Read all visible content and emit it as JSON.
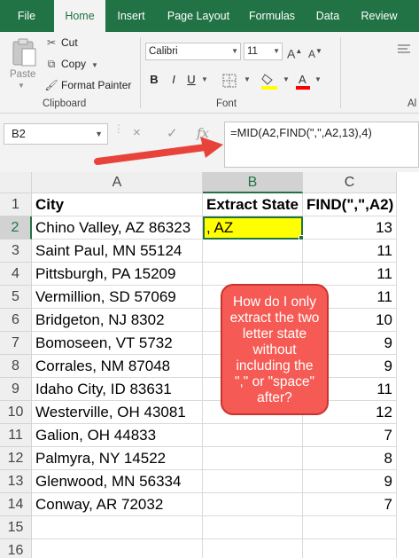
{
  "ribbon": {
    "tabs": [
      "File",
      "Home",
      "Insert",
      "Page Layout",
      "Formulas",
      "Data",
      "Review"
    ],
    "active_tab": "Home",
    "clipboard": {
      "paste_label": "Paste",
      "cut_label": "Cut",
      "copy_label": "Copy",
      "format_painter_label": "Format Painter",
      "group_label": "Clipboard"
    },
    "font": {
      "font_name": "Calibri",
      "font_size": "11",
      "bold": "B",
      "italic": "I",
      "underline": "U",
      "group_label": "Font",
      "fill_color": "#ffff00",
      "font_color": "#ff0000"
    },
    "alignment_group_label_partial": "Al"
  },
  "formula_bar": {
    "name_box": "B2",
    "cancel_icon": "×",
    "enter_icon": "✓",
    "fx_label": "fx",
    "formula": "=MID(A2,FIND(\",\",A2,13),4)"
  },
  "sheet": {
    "columns": [
      "A",
      "B",
      "C"
    ],
    "rows": [
      {
        "n": "1",
        "a": "City",
        "b": "Extract State",
        "c": "FIND(\",\",A2)"
      },
      {
        "n": "2",
        "a": "Chino Valley, AZ 86323",
        "b": ", AZ",
        "c": "13"
      },
      {
        "n": "3",
        "a": "Saint Paul, MN 55124",
        "b": "",
        "c": "11"
      },
      {
        "n": "4",
        "a": "Pittsburgh, PA 15209",
        "b": "",
        "c": "11"
      },
      {
        "n": "5",
        "a": "Vermillion, SD 57069",
        "b": "",
        "c": "11"
      },
      {
        "n": "6",
        "a": "Bridgeton, NJ 8302",
        "b": "",
        "c": "10"
      },
      {
        "n": "7",
        "a": "Bomoseen, VT 5732",
        "b": "",
        "c": "9"
      },
      {
        "n": "8",
        "a": "Corrales, NM 87048",
        "b": "",
        "c": "9"
      },
      {
        "n": "9",
        "a": "Idaho City, ID 83631",
        "b": "",
        "c": "11"
      },
      {
        "n": "10",
        "a": "Westerville, OH 43081",
        "b": "",
        "c": "12"
      },
      {
        "n": "11",
        "a": "Galion, OH 44833",
        "b": "",
        "c": "7"
      },
      {
        "n": "12",
        "a": "Palmyra, NY 14522",
        "b": "",
        "c": "8"
      },
      {
        "n": "13",
        "a": "Glenwood, MN 56334",
        "b": "",
        "c": "9"
      },
      {
        "n": "14",
        "a": "Conway, AR 72032",
        "b": "",
        "c": "7"
      },
      {
        "n": "15",
        "a": "",
        "b": "",
        "c": ""
      },
      {
        "n": "16",
        "a": "",
        "b": "",
        "c": ""
      }
    ]
  },
  "callout": {
    "text": "How do I only extract the two letter state without including the \",\" or \"space\" after?"
  },
  "colors": {
    "excel_green": "#217346",
    "highlight_yellow": "#ffff00",
    "callout_red": "#f65a54",
    "arrow_red": "#e8433a"
  }
}
